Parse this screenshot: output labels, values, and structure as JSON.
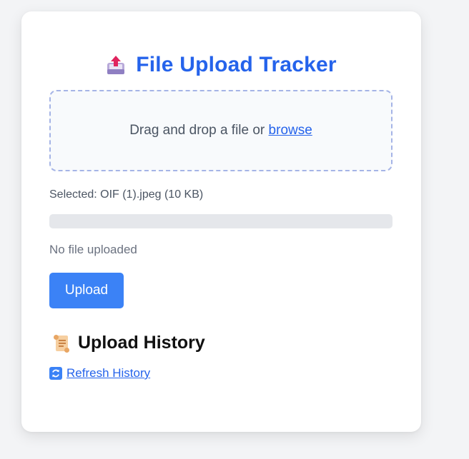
{
  "header": {
    "title": "File Upload Tracker",
    "icon": "outbox-tray-icon"
  },
  "dropzone": {
    "prompt": "Drag and drop a file or",
    "browse_label": "browse"
  },
  "selection": {
    "text": "Selected: OIF (1).jpeg (10 KB)"
  },
  "progress": {
    "percent": 0
  },
  "status": {
    "text": "No file uploaded"
  },
  "actions": {
    "upload_label": "Upload"
  },
  "history": {
    "title": "Upload History",
    "icon": "scroll-icon",
    "refresh_label": "Refresh History",
    "refresh_icon": "refresh-icon"
  },
  "colors": {
    "accent": "#2563eb",
    "button": "#3b82f6",
    "dropzone_border": "#a5b4e6",
    "progress_track": "#e5e7eb"
  }
}
